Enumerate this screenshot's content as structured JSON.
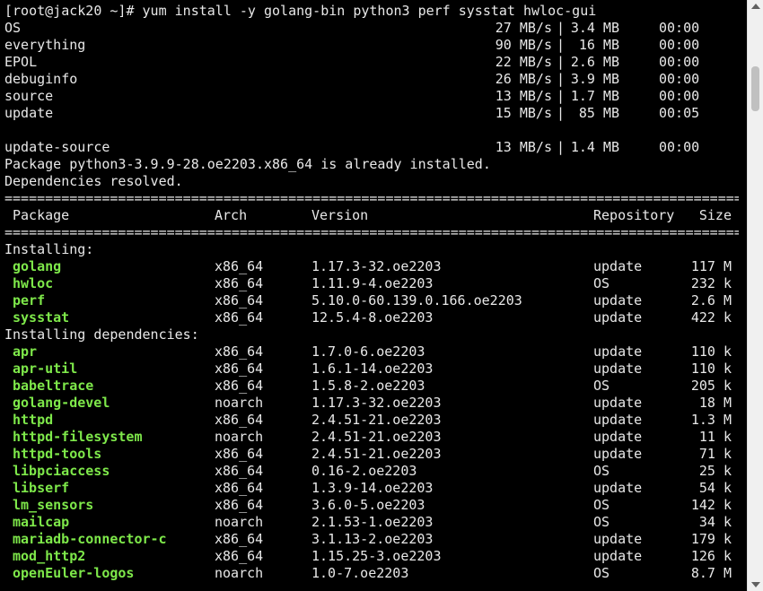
{
  "terminal": {
    "prompt": "[root@jack20 ~]# ",
    "command": "yum install -y golang-bin python3 perf sysstat hwloc-gui",
    "repos": [
      {
        "name": "OS",
        "rate": "27 MB/s",
        "size": "3.4 MB",
        "time": "00:00"
      },
      {
        "name": "everything",
        "rate": "90 MB/s",
        "size": "16 MB",
        "time": "00:00"
      },
      {
        "name": "EPOL",
        "rate": "22 MB/s",
        "size": "2.6 MB",
        "time": "00:00"
      },
      {
        "name": "debuginfo",
        "rate": "26 MB/s",
        "size": "3.9 MB",
        "time": "00:00"
      },
      {
        "name": "source",
        "rate": "13 MB/s",
        "size": "1.7 MB",
        "time": "00:00"
      },
      {
        "name": "update",
        "rate": "15 MB/s",
        "size": "85 MB",
        "time": "00:05"
      },
      {
        "name": "update-source",
        "rate": "13 MB/s",
        "size": "1.4 MB",
        "time": "00:00"
      }
    ],
    "already_installed": "Package python3-3.9.9-28.oe2203.x86_64 is already installed.",
    "deps_resolved": "Dependencies resolved.",
    "separator": "================================================================================================",
    "header": {
      "package": "Package",
      "arch": "Arch",
      "version": "Version",
      "repository": "Repository",
      "size": "Size"
    },
    "installing_label": "Installing:",
    "installing": [
      {
        "name": "golang",
        "arch": "x86_64",
        "version": "1.17.3-32.oe2203",
        "repo": "update",
        "size": "117 M"
      },
      {
        "name": "hwloc",
        "arch": "x86_64",
        "version": "1.11.9-4.oe2203",
        "repo": "OS",
        "size": "232 k"
      },
      {
        "name": "perf",
        "arch": "x86_64",
        "version": "5.10.0-60.139.0.166.oe2203",
        "repo": "update",
        "size": "2.6 M"
      },
      {
        "name": "sysstat",
        "arch": "x86_64",
        "version": "12.5.4-8.oe2203",
        "repo": "update",
        "size": "422 k"
      }
    ],
    "deps_label": "Installing dependencies:",
    "dependencies": [
      {
        "name": "apr",
        "arch": "x86_64",
        "version": "1.7.0-6.oe2203",
        "repo": "update",
        "size": "110 k"
      },
      {
        "name": "apr-util",
        "arch": "x86_64",
        "version": "1.6.1-14.oe2203",
        "repo": "update",
        "size": "110 k"
      },
      {
        "name": "babeltrace",
        "arch": "x86_64",
        "version": "1.5.8-2.oe2203",
        "repo": "OS",
        "size": "205 k"
      },
      {
        "name": "golang-devel",
        "arch": "noarch",
        "version": "1.17.3-32.oe2203",
        "repo": "update",
        "size": "18 M"
      },
      {
        "name": "httpd",
        "arch": "x86_64",
        "version": "2.4.51-21.oe2203",
        "repo": "update",
        "size": "1.3 M"
      },
      {
        "name": "httpd-filesystem",
        "arch": "noarch",
        "version": "2.4.51-21.oe2203",
        "repo": "update",
        "size": "11 k"
      },
      {
        "name": "httpd-tools",
        "arch": "x86_64",
        "version": "2.4.51-21.oe2203",
        "repo": "update",
        "size": "71 k"
      },
      {
        "name": "libpciaccess",
        "arch": "x86_64",
        "version": "0.16-2.oe2203",
        "repo": "OS",
        "size": "25 k"
      },
      {
        "name": "libserf",
        "arch": "x86_64",
        "version": "1.3.9-14.oe2203",
        "repo": "update",
        "size": "54 k"
      },
      {
        "name": "lm_sensors",
        "arch": "x86_64",
        "version": "3.6.0-5.oe2203",
        "repo": "OS",
        "size": "142 k"
      },
      {
        "name": "mailcap",
        "arch": "noarch",
        "version": "2.1.53-1.oe2203",
        "repo": "OS",
        "size": "34 k"
      },
      {
        "name": "mariadb-connector-c",
        "arch": "x86_64",
        "version": "3.1.13-2.oe2203",
        "repo": "update",
        "size": "179 k"
      },
      {
        "name": "mod_http2",
        "arch": "x86_64",
        "version": "1.15.25-3.oe2203",
        "repo": "update",
        "size": "126 k"
      },
      {
        "name": "openEuler-logos",
        "arch": "noarch",
        "version": "1.0-7.oe2203",
        "repo": "OS",
        "size": "8.7 M"
      }
    ]
  },
  "colors": {
    "background": "#000000",
    "text": "#e8e8e8",
    "package_name": "#7ee84a"
  }
}
